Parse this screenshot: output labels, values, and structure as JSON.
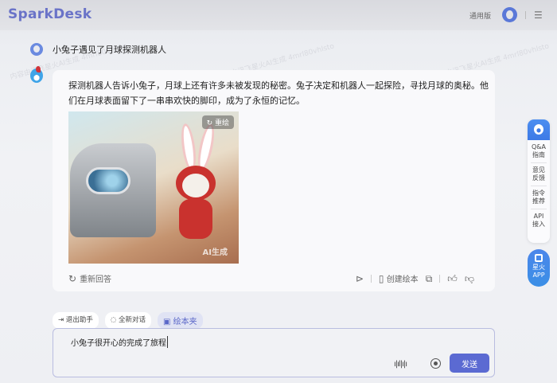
{
  "header": {
    "logo": "SparkDesk",
    "version": "通用版",
    "menu_icon": "menu-icon",
    "avatar_icon": "user-avatar"
  },
  "conversation": {
    "user_prompt": "小兔子遇见了月球探测机器人",
    "answer": "探测机器人告诉小兔子，月球上还有许多未被发现的秘密。兔子决定和机器人一起探险，寻找月球的奥秘。他们在月球表面留下了一串串欢快的脚印，成为了永恒的记忆。",
    "image": {
      "redraw_label": "重绘",
      "watermark": "AI生成"
    },
    "actions": {
      "regenerate": "重新回答",
      "create_book": "创建绘本"
    }
  },
  "chips": [
    {
      "label": "退出助手"
    },
    {
      "label": "全新对话"
    },
    {
      "label": "绘本夹"
    }
  ],
  "input": {
    "value": "小兔子很开心的完成了旅程",
    "send_label": "发送"
  },
  "sidebar": {
    "items": [
      {
        "label": "Q&A 指南"
      },
      {
        "label": "意见 反馈"
      },
      {
        "label": "指令 推荐"
      },
      {
        "label": "API 接入"
      }
    ],
    "app_label": "星火 APP"
  },
  "watermark_text": "内容由讯飞星火AI生成 4mrl80vhlsto",
  "colors": {
    "accent": "#5b6ad2",
    "brand": "#6a73c8",
    "side_blue": "#3d7ae6"
  }
}
